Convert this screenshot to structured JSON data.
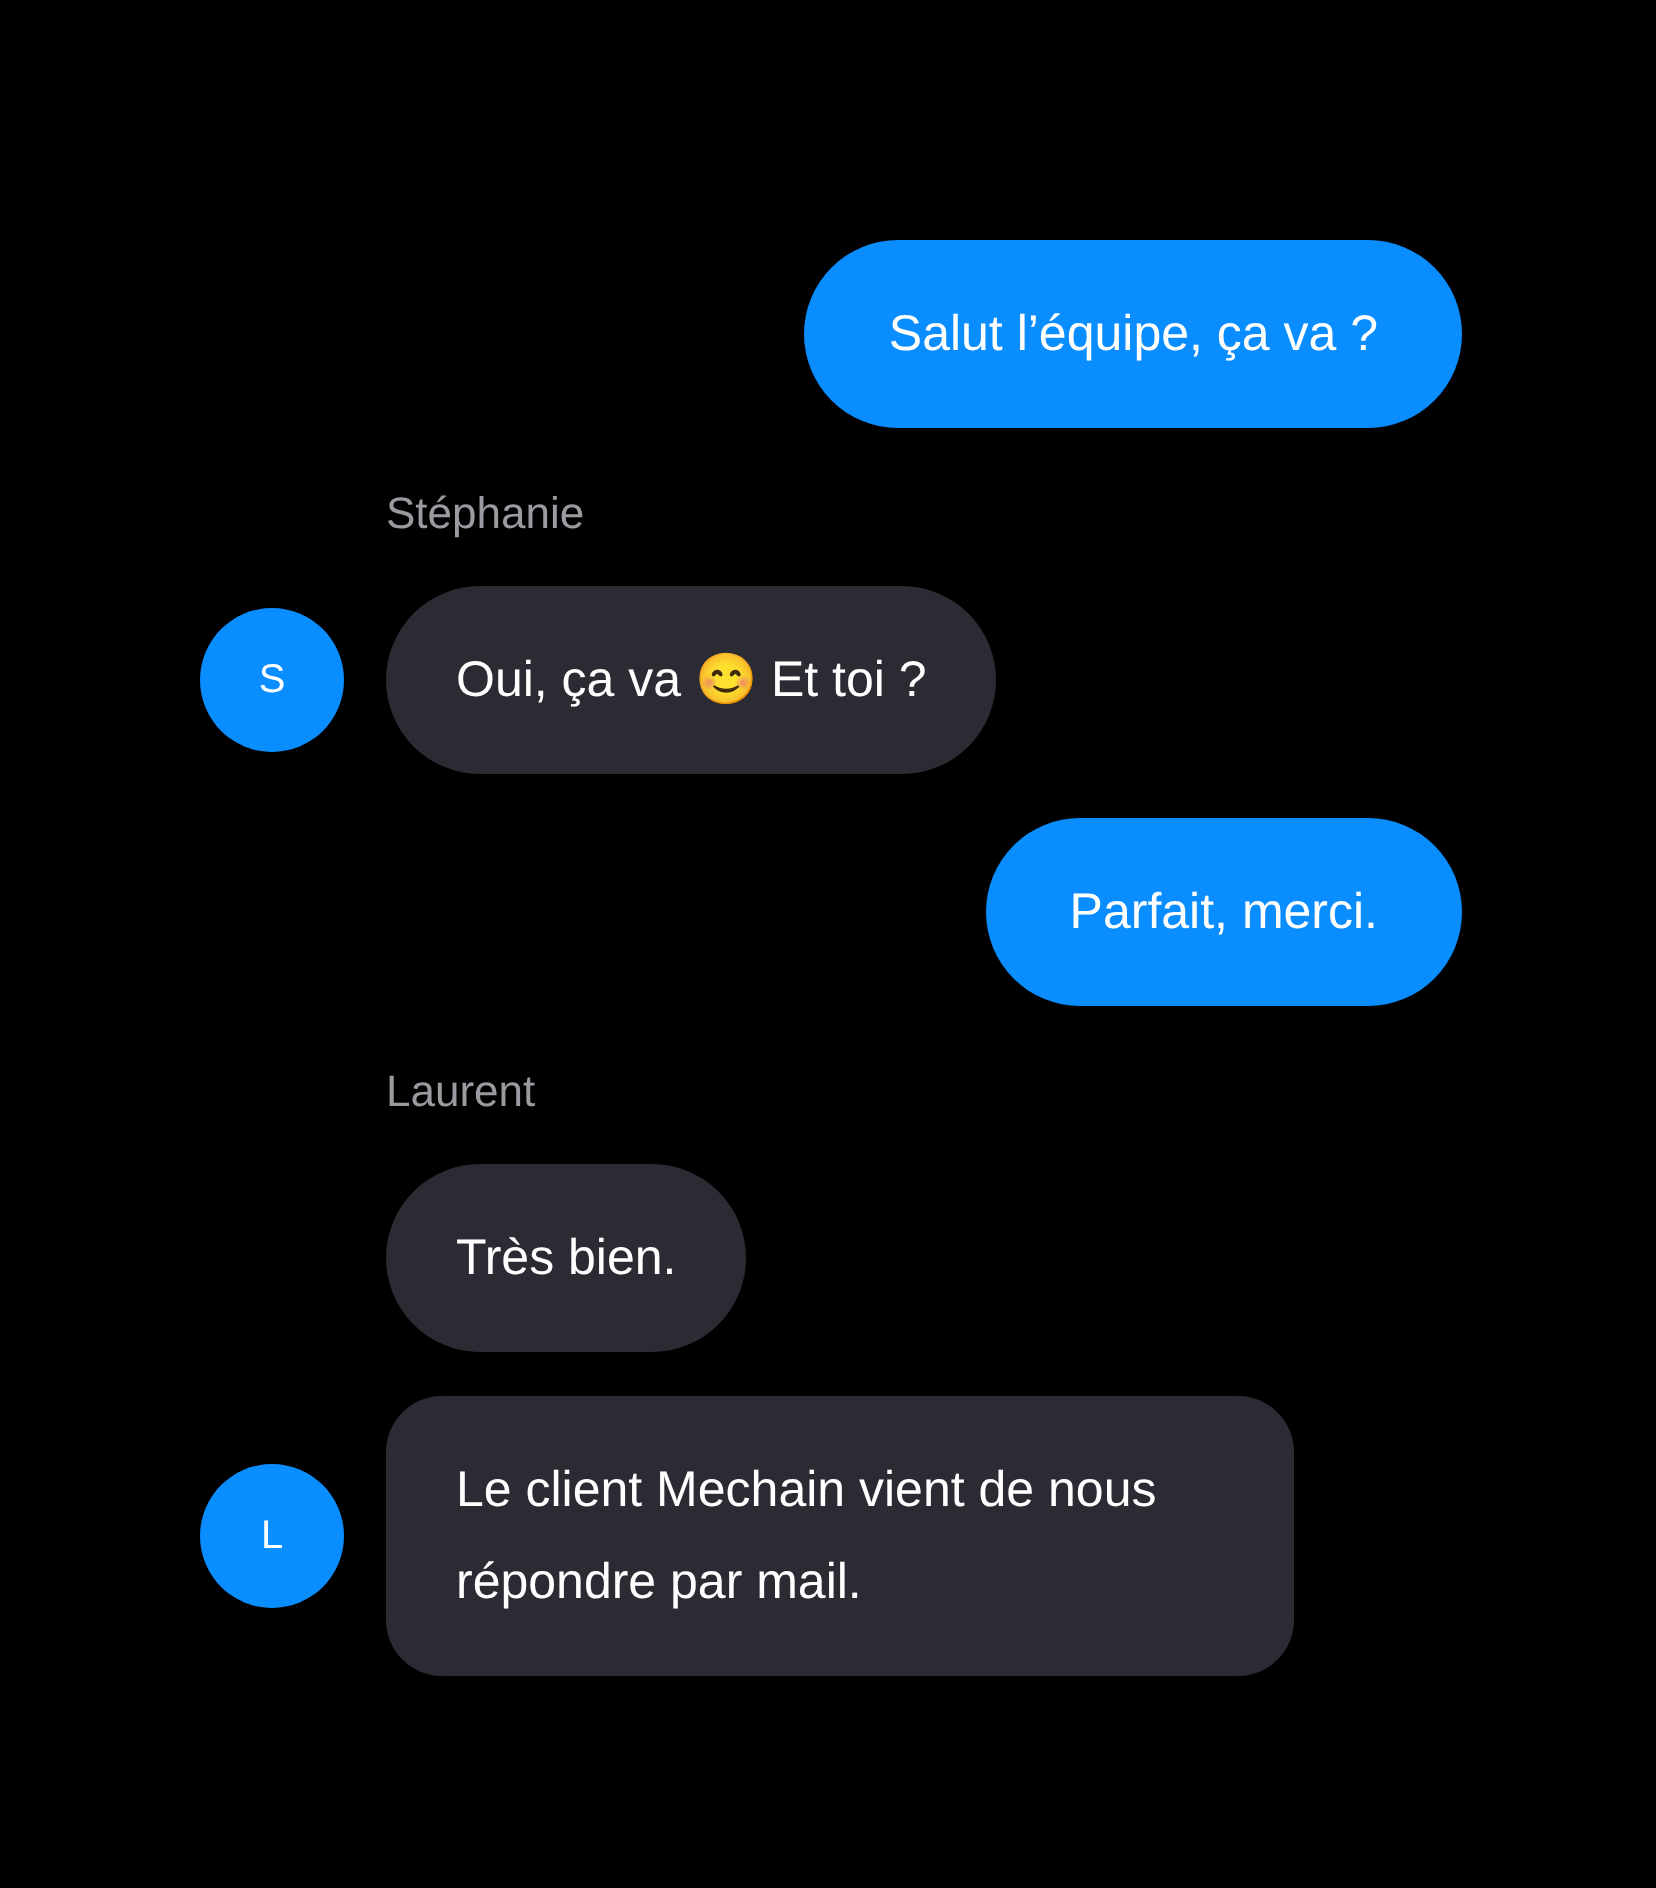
{
  "messages": [
    {
      "kind": "outgoing",
      "text": "Salut l’équipe, ça va ?"
    },
    {
      "kind": "incoming",
      "sender": "Stéphanie",
      "avatar": "S",
      "bubbles": [
        "Oui, ça va 😊 Et toi ?"
      ]
    },
    {
      "kind": "outgoing",
      "text": "Parfait, merci."
    },
    {
      "kind": "incoming",
      "sender": "Laurent",
      "avatar": "L",
      "bubbles": [
        "Très bien.",
        "Le client Mechain vient de nous répondre par mail."
      ]
    }
  ]
}
